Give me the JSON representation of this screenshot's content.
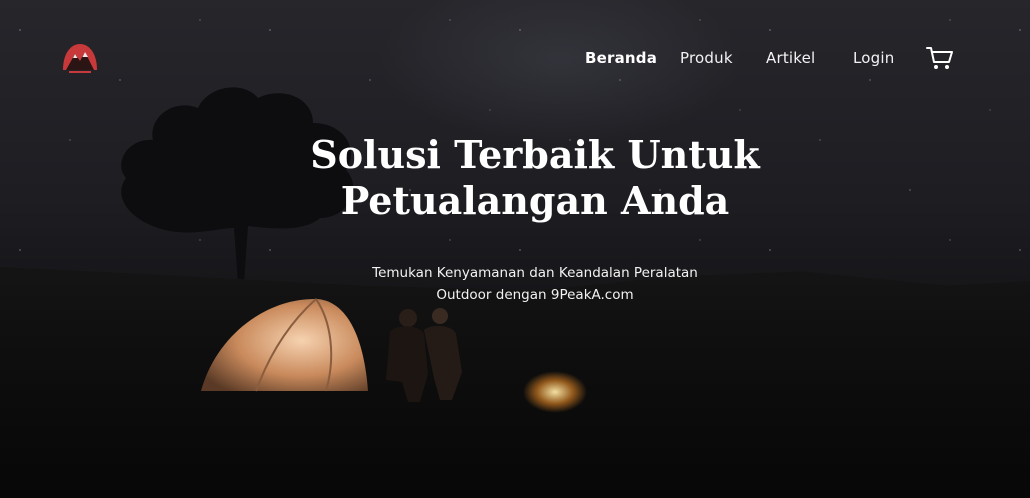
{
  "nav": {
    "items": [
      {
        "label": "Beranda",
        "active": true
      },
      {
        "label": "Produk",
        "active": false
      },
      {
        "label": "Artikel",
        "active": false
      },
      {
        "label": "Login",
        "active": false
      }
    ],
    "cart_icon": "shopping-cart-icon"
  },
  "hero": {
    "title_line1": "Solusi Terbaik Untuk",
    "title_line2": "Petualangan Anda",
    "subtitle_line1": "Temukan Kenyamanan dan Keandalan Peralatan",
    "subtitle_line2": "Outdoor dengan 9PeakA.com"
  },
  "colors": {
    "logo_red": "#c8393b",
    "text": "#ffffff",
    "background": "#1d1d22"
  }
}
